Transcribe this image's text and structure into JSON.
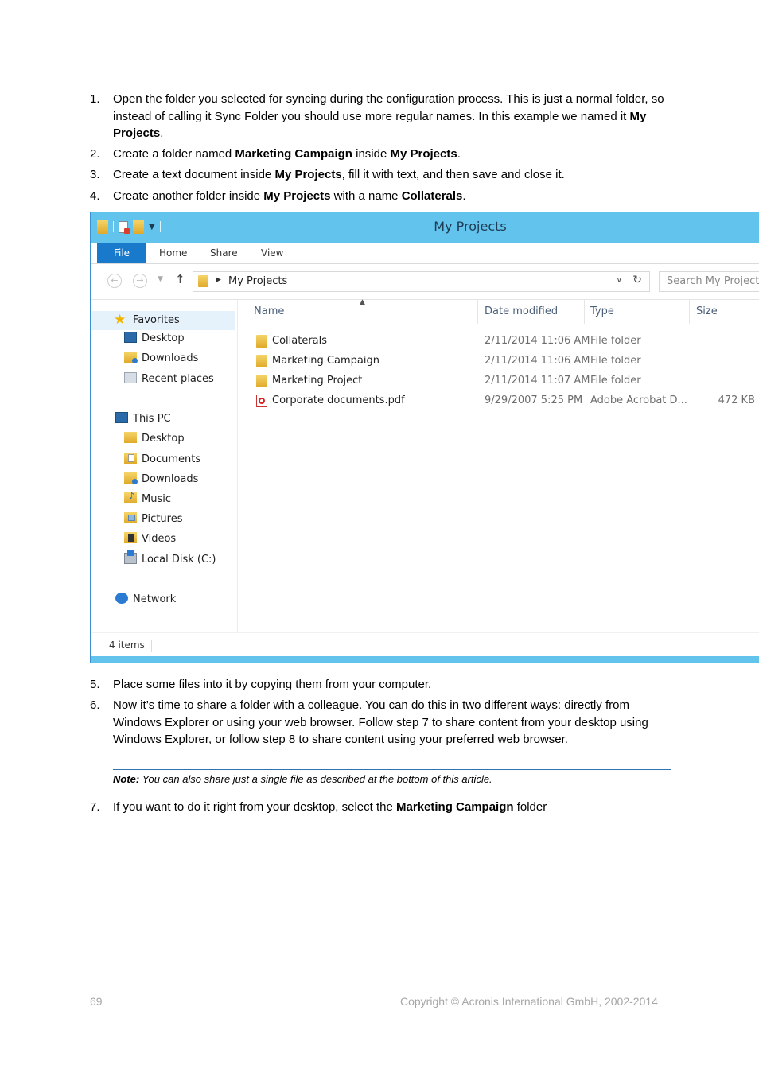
{
  "steps_top": [
    {
      "num": "1.",
      "parts": [
        {
          "t": "Open the folder you selected for syncing during the configuration process. This is just a normal folder, so instead of calling it Sync Folder you should use more regular names. In this example we named it ",
          "b": false
        },
        {
          "t": "My Projects",
          "b": true
        },
        {
          "t": ".",
          "b": false
        }
      ]
    },
    {
      "num": "2.",
      "parts": [
        {
          "t": "Create a folder named ",
          "b": false
        },
        {
          "t": "Marketing Campaign",
          "b": true
        },
        {
          "t": " inside ",
          "b": false
        },
        {
          "t": "My Projects",
          "b": true
        },
        {
          "t": ".",
          "b": false
        }
      ]
    },
    {
      "num": "3.",
      "parts": [
        {
          "t": "Create a text document inside ",
          "b": false
        },
        {
          "t": "My Projects",
          "b": true
        },
        {
          "t": ", fill it with text, and then save and close it.",
          "b": false
        }
      ]
    },
    {
      "num": "4.",
      "parts": [
        {
          "t": "Create another folder inside ",
          "b": false
        },
        {
          "t": "My Projects",
          "b": true
        },
        {
          "t": " with a name ",
          "b": false
        },
        {
          "t": "Collaterals",
          "b": true
        },
        {
          "t": ".",
          "b": false
        }
      ]
    }
  ],
  "explorer": {
    "title": "My Projects",
    "ribbon_tabs": [
      "File",
      "Home",
      "Share",
      "View"
    ],
    "address_path": "My Projects",
    "search_placeholder": "Search My Projects",
    "nav": {
      "favorites_label": "Favorites",
      "favorites": [
        "Desktop",
        "Downloads",
        "Recent places"
      ],
      "this_pc_label": "This PC",
      "this_pc": [
        "Desktop",
        "Documents",
        "Downloads",
        "Music",
        "Pictures",
        "Videos",
        "Local Disk (C:)"
      ],
      "network_label": "Network"
    },
    "columns": [
      "Name",
      "Date modified",
      "Type",
      "Size"
    ],
    "files": [
      {
        "name": "Collaterals",
        "date": "2/11/2014 11:06 AM",
        "type": "File folder",
        "size": "",
        "icon": "folder-icon"
      },
      {
        "name": "Marketing Campaign",
        "date": "2/11/2014 11:06 AM",
        "type": "File folder",
        "size": "",
        "icon": "folder-icon"
      },
      {
        "name": "Marketing Project",
        "date": "2/11/2014 11:07 AM",
        "type": "File folder",
        "size": "",
        "icon": "folder-icon"
      },
      {
        "name": "Corporate documents.pdf",
        "date": "9/29/2007 5:25 PM",
        "type": "Adobe Acrobat D...",
        "size": "472 KB",
        "icon": "pdf-icon"
      }
    ],
    "status_text": "4 items"
  },
  "steps_bottom": [
    {
      "num": "5.",
      "parts": [
        {
          "t": "Place some files into it by copying them from your computer.",
          "b": false
        }
      ]
    },
    {
      "num": "6.",
      "parts": [
        {
          "t": "Now it’s time to share a folder with a colleague. You can do this in two different ways: directly from Windows Explorer or using your web browser. Follow step 7 to share content from your desktop using Windows Explorer, or follow step 8 to share content using your preferred web browser.",
          "b": false
        }
      ]
    }
  ],
  "note": {
    "label": "Note:",
    "text": " You can also share just a single file as described at the bottom of this article."
  },
  "step7": {
    "num": "7.",
    "parts": [
      {
        "t": "If you want to do it right from your desktop, select the ",
        "b": false
      },
      {
        "t": "Marketing Campaign",
        "b": true
      },
      {
        "t": " folder",
        "b": false
      }
    ]
  },
  "footer": {
    "page": "69",
    "copyright": "Copyright © Acronis International GmbH, 2002-2014"
  }
}
